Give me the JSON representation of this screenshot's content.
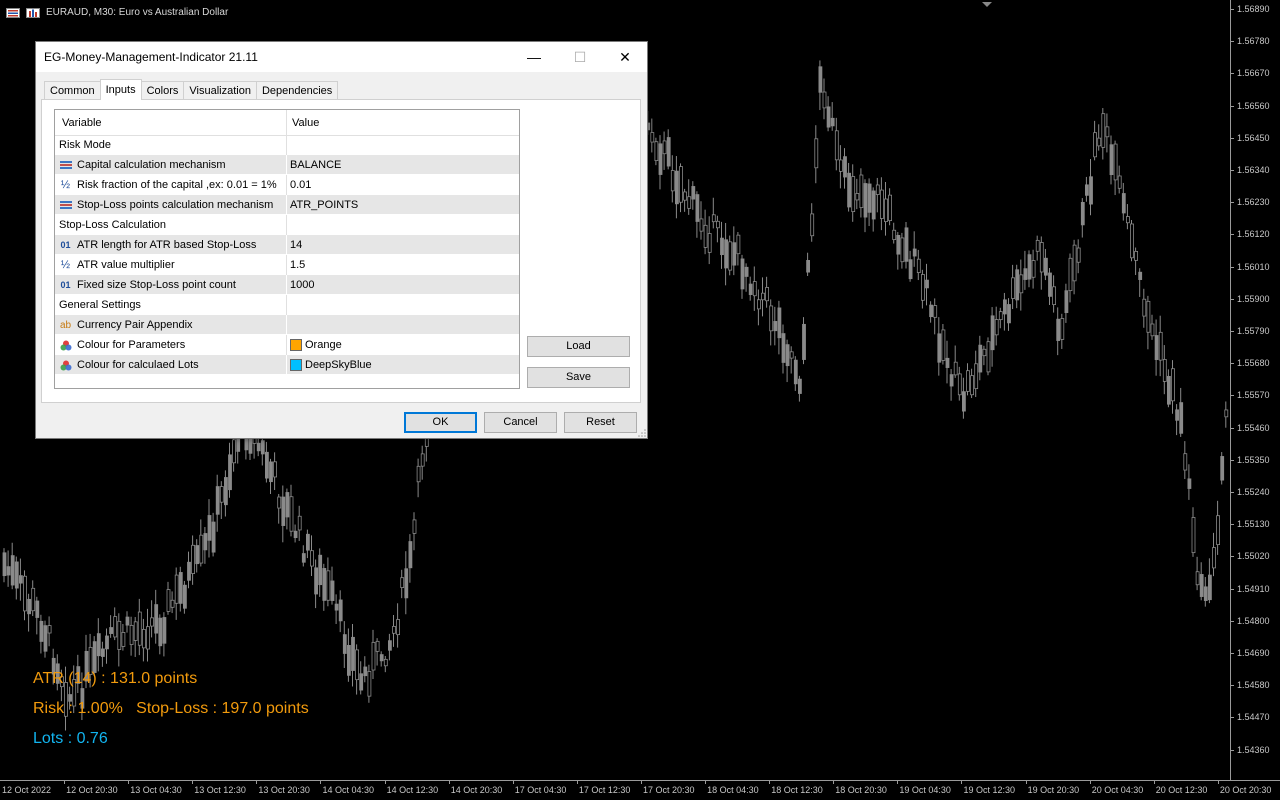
{
  "chart": {
    "header": "EURAUD, M30:  Euro vs Australian Dollar",
    "header_icons": [
      "window-list-icon",
      "chart-bars-icon"
    ],
    "background": "#000000",
    "candle_color": "#8a8a8a",
    "price_labels": [
      "1.56890",
      "1.56780",
      "1.56670",
      "1.56560",
      "1.56450",
      "1.56340",
      "1.56230",
      "1.56120",
      "1.56010",
      "1.55900",
      "1.55790",
      "1.55680",
      "1.55570",
      "1.55460",
      "1.55350",
      "1.55240",
      "1.55130",
      "1.55020",
      "1.54910",
      "1.54800",
      "1.54690",
      "1.54580",
      "1.54470",
      "1.54360"
    ],
    "time_labels": [
      "12 Oct 2022",
      "12 Oct 20:30",
      "13 Oct 04:30",
      "13 Oct 12:30",
      "13 Oct 20:30",
      "14 Oct 04:30",
      "14 Oct 12:30",
      "14 Oct 20:30",
      "17 Oct 04:30",
      "17 Oct 12:30",
      "17 Oct 20:30",
      "18 Oct 04:30",
      "18 Oct 12:30",
      "18 Oct 20:30",
      "19 Oct 04:30",
      "19 Oct 12:30",
      "19 Oct 20:30",
      "20 Oct 04:30",
      "20 Oct 12:30",
      "20 Oct 20:30"
    ]
  },
  "overlay": {
    "atr_line": "ATR (14) : 131.0 points",
    "risk_line": "Risk : 1.00%   Stop-Loss : 197.0 points",
    "lots_line": "Lots : 0.76",
    "param_color": "#f29b0d",
    "lots_color": "#12b4ef"
  },
  "dialog": {
    "title": "EG-Money-Management-Indicator 21.11",
    "minimize": "—",
    "maximize": "☐",
    "close": "✕",
    "tabs": [
      "Common",
      "Inputs",
      "Colors",
      "Visualization",
      "Dependencies"
    ],
    "active_tab": "Inputs",
    "grid": {
      "col_variable": "Variable",
      "col_value": "Value",
      "rows": [
        {
          "variable": "Risk Mode",
          "value": "",
          "icon": "",
          "group": true
        },
        {
          "variable": "Capital calculation mechanism",
          "value": "BALANCE",
          "icon": "enum-icon"
        },
        {
          "variable": "Risk fraction of the capital ,ex: 0.01 = 1%",
          "value": "0.01",
          "icon": "fraction-icon"
        },
        {
          "variable": "Stop-Loss points calculation mechanism",
          "value": "ATR_POINTS",
          "icon": "enum-icon"
        },
        {
          "variable": "Stop-Loss Calculation",
          "value": "",
          "icon": "",
          "group": true
        },
        {
          "variable": "ATR length for ATR based Stop-Loss",
          "value": "14",
          "icon": "integer-icon"
        },
        {
          "variable": "ATR value multiplier",
          "value": "1.5",
          "icon": "fraction-icon"
        },
        {
          "variable": "Fixed size Stop-Loss point count",
          "value": "1000",
          "icon": "integer-icon"
        },
        {
          "variable": "General Settings",
          "value": "",
          "icon": "",
          "group": true
        },
        {
          "variable": "Currency Pair Appendix",
          "value": "",
          "icon": "string-icon"
        },
        {
          "variable": "Colour for Parameters",
          "value": "Orange",
          "icon": "color-icon",
          "swatch": "#ffa500"
        },
        {
          "variable": "Colour for calculaed Lots",
          "value": "DeepSkyBlue",
          "icon": "color-icon",
          "swatch": "#00bfff"
        }
      ]
    },
    "load_label": "Load",
    "save_label": "Save",
    "ok_label": "OK",
    "cancel_label": "Cancel",
    "reset_label": "Reset"
  }
}
